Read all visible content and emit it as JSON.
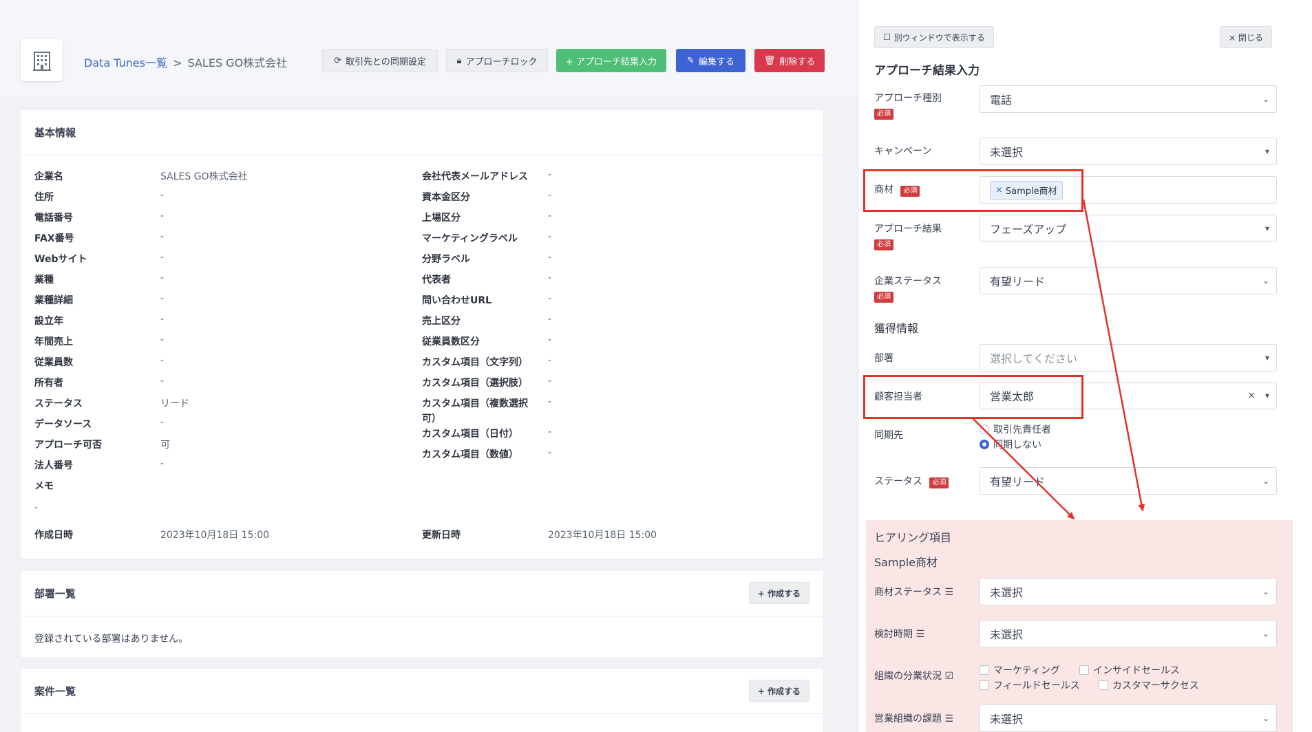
{
  "header": {
    "breadcrumb_link": "Data Tunes一覧",
    "breadcrumb_sep": ">",
    "breadcrumb_current": "SALES GO株式会社",
    "buttons": {
      "sync": "取引先との同期設定",
      "lock": "アプローチロック",
      "approach_input": "+ アプローチ結果入力",
      "edit": "編集する",
      "delete": "削除する"
    }
  },
  "basic_info": {
    "title": "基本情報",
    "left": [
      {
        "label": "企業名",
        "value": "SALES GO株式会社"
      },
      {
        "label": "住所",
        "value": "-"
      },
      {
        "label": "電話番号",
        "value": "-"
      },
      {
        "label": "FAX番号",
        "value": "-"
      },
      {
        "label": "Webサイト",
        "value": "-"
      },
      {
        "label": "業種",
        "value": "-"
      },
      {
        "label": "業種詳細",
        "value": "-"
      },
      {
        "label": "設立年",
        "value": "-"
      },
      {
        "label": "年間売上",
        "value": "-"
      },
      {
        "label": "従業員数",
        "value": "-"
      },
      {
        "label": "所有者",
        "value": "-"
      },
      {
        "label": "ステータス",
        "value": "リード"
      },
      {
        "label": "データソース",
        "value": "-"
      },
      {
        "label": "アプローチ可否",
        "value": "可"
      },
      {
        "label": "法人番号",
        "value": "-"
      },
      {
        "label": "メモ",
        "value": ""
      }
    ],
    "memo_value": "-",
    "right": [
      {
        "label": "会社代表メールアドレス",
        "value": "-"
      },
      {
        "label": "資本金区分",
        "value": "-"
      },
      {
        "label": "上場区分",
        "value": "-"
      },
      {
        "label": "マーケティングラベル",
        "value": "-"
      },
      {
        "label": "分野ラベル",
        "value": "-"
      },
      {
        "label": "代表者",
        "value": "-"
      },
      {
        "label": "問い合わせURL",
        "value": "-"
      },
      {
        "label": "売上区分",
        "value": "-"
      },
      {
        "label": "従業員数区分",
        "value": "-"
      },
      {
        "label": "カスタム項目（文字列）",
        "value": "-"
      },
      {
        "label": "カスタム項目（選択肢）",
        "value": "-"
      },
      {
        "label": "カスタム項目（複数選択",
        "value": "-"
      },
      {
        "label": "可）",
        "value": ""
      },
      {
        "label": "カスタム項目（日付）",
        "value": "-"
      },
      {
        "label": "カスタム項目（数値）",
        "value": "-"
      }
    ],
    "created_label": "作成日時",
    "created_value": "2023年10月18日 15:00",
    "updated_label": "更新日時",
    "updated_value": "2023年10月18日 15:00"
  },
  "departments": {
    "title": "部署一覧",
    "create": "+ 作成する",
    "empty": "登録されている部署はありません。"
  },
  "deals": {
    "title": "案件一覧",
    "create": "+ 作成する"
  },
  "panel": {
    "open_window": "別ウィンドウで表示する",
    "close": "× 閉じる",
    "title": "アプローチ結果入力",
    "required": "必須",
    "fields": {
      "approach_type_label": "アプローチ種別",
      "approach_type_value": "電話",
      "campaign_label": "キャンペーン",
      "campaign_value": "未選択",
      "material_label": "商材",
      "material_tag": "Sample商材",
      "result_label": "アプローチ結果",
      "result_value": "フェーズアップ",
      "company_status_label": "企業ステータス",
      "company_status_value": "有望リード",
      "acquired_title": "獲得情報",
      "dept_label": "部署",
      "dept_placeholder": "選択してください",
      "contact_label": "顧客担当者",
      "contact_value": "営業太郎",
      "sync_label": "同期先",
      "sync_opt1": "取引先責任者",
      "sync_opt2": "同期しない",
      "status_label": "ステータス",
      "status_value": "有望リード"
    },
    "hearing": {
      "title": "ヒアリング項目",
      "material": "Sample商材",
      "material_status_label": "商材ステータス",
      "material_status_value": "未選択",
      "review_label": "検討時期",
      "review_value": "未選択",
      "org_label": "組織の分業状況",
      "org_opts": [
        "マーケティング",
        "インサイドセールス",
        "フィールドセールス",
        "カスタマーサクセス"
      ],
      "issue_label": "営業組織の課題",
      "issue_value": "未選択"
    }
  },
  "colors": {
    "highlight": "#e0332a",
    "green": "#4fbf77",
    "blue": "#3d63d2",
    "red": "#d9384d",
    "pink_bg": "#fbe6e6"
  }
}
